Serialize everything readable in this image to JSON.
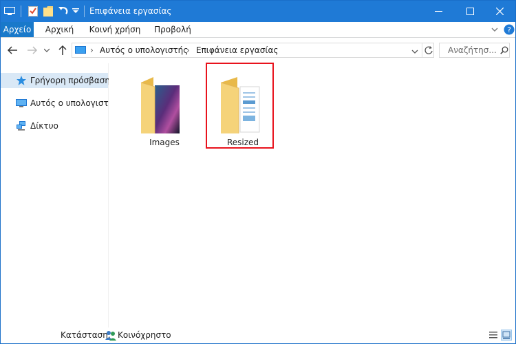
{
  "window": {
    "title": "Επιφάνεια εργασίας"
  },
  "ribbon": {
    "tabs": [
      {
        "label": "Αρχείο"
      },
      {
        "label": "Αρχική"
      },
      {
        "label": "Κοινή χρήση"
      },
      {
        "label": "Προβολή"
      }
    ]
  },
  "address": {
    "breadcrumbs": [
      "Αυτός ο υπολογιστής",
      "Επιφάνεια εργασίας"
    ],
    "separator": "›"
  },
  "search": {
    "placeholder": "Αναζήτησ..."
  },
  "navpane": {
    "items": [
      {
        "label": "Γρήγορη πρόσβαση",
        "icon": "star-icon"
      },
      {
        "label": "Αυτός ο υπολογιστή",
        "icon": "computer-icon"
      },
      {
        "label": "Δίκτυο",
        "icon": "network-icon"
      }
    ]
  },
  "content": {
    "items": [
      {
        "name": "Images",
        "icon": "folder-with-images-icon"
      },
      {
        "name": "Resized",
        "icon": "folder-with-documents-icon",
        "highlighted": true
      }
    ]
  },
  "status": {
    "label": "Κατάσταση:",
    "value": "Κοινόχρηστο"
  },
  "colors": {
    "titlebar": "#1f7ad6",
    "file_tab": "#1979ca",
    "selection": "#d9e8f6",
    "highlight_box": "#e8121c",
    "folder": "#f5d37a"
  }
}
